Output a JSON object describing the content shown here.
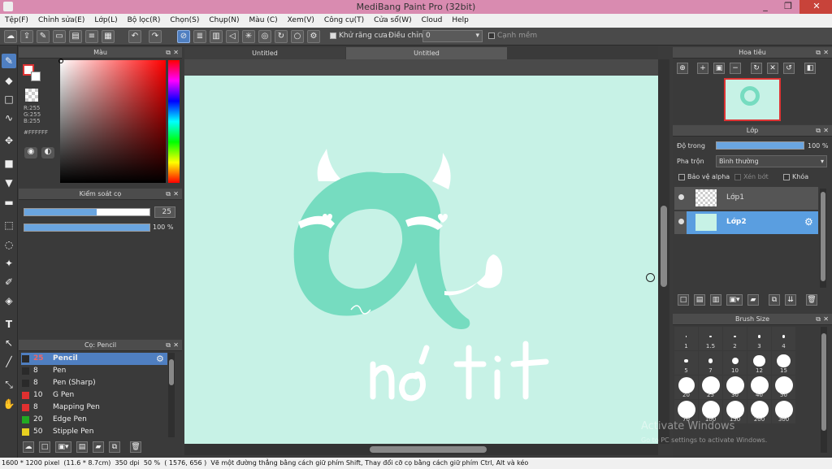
{
  "window": {
    "title": "MediBang Paint Pro (32bit)",
    "minimize": "_",
    "restore": "❐",
    "close": "✕"
  },
  "menu": [
    "Tệp(F)",
    "Chỉnh sửa(E)",
    "Lớp(L)",
    "Bộ lọc(R)",
    "Chọn(S)",
    "Chụp(N)",
    "Màu (C)",
    "Xem(V)",
    "Công cụ(T)",
    "Cửa sổ(W)",
    "Cloud",
    "Help"
  ],
  "toolbar": {
    "antialias_label": "Khử răng cưa",
    "adjust_label": "Điều chỉnh",
    "adjust_value": "0",
    "snap_label": "Cạnh mềm"
  },
  "color_panel": {
    "title": "Màu",
    "r": "R:255",
    "g": "G:255",
    "b": "B:255",
    "hex": "#FFFFFF"
  },
  "brush_control": {
    "title": "Kiểm soát cọ",
    "size": "25",
    "opacity": "100 %",
    "size_fill": 0.58,
    "opacity_fill": 1.0
  },
  "brush_panel": {
    "title": "Cọ: Pencil",
    "items": [
      {
        "size": "25",
        "name": "Pencil",
        "color": "#2a2a2a"
      },
      {
        "size": "8",
        "name": "Pen",
        "color": "#2a2a2a"
      },
      {
        "size": "8",
        "name": "Pen (Sharp)",
        "color": "#2a2a2a"
      },
      {
        "size": "10",
        "name": "G Pen",
        "color": "#e03030"
      },
      {
        "size": "8",
        "name": "Mapping Pen",
        "color": "#e03030"
      },
      {
        "size": "20",
        "name": "Edge Pen",
        "color": "#22aa22"
      },
      {
        "size": "50",
        "name": "Stipple Pen",
        "color": "#e8d020"
      }
    ]
  },
  "tabs": [
    "Untitled",
    "Untitled"
  ],
  "navigator": {
    "title": "Hoa tiêu"
  },
  "layers": {
    "title": "Lớp",
    "opacity_label": "Độ trong",
    "opacity_value": "100 %",
    "opacity_fill": 1.0,
    "blend_label": "Pha trộn",
    "blend_value": "Bình thường",
    "protect_alpha": "Bảo vệ alpha",
    "clipping": "Xén bớt",
    "lock": "Khóa",
    "items": [
      "Lớp1",
      "Lớp2"
    ]
  },
  "brush_size": {
    "title": "Brush Size",
    "sizes": [
      "1",
      "1.5",
      "2",
      "3",
      "4",
      "5",
      "7",
      "10",
      "12",
      "15",
      "20",
      "25",
      "30",
      "40",
      "50",
      "70",
      "100",
      "150",
      "200",
      "300"
    ]
  },
  "watermark": {
    "line1": "Activate Windows",
    "line2": "Go to PC settings to activate Windows."
  },
  "status": {
    "dims": "1600 * 1200 pixel",
    "cm": "(11.6 * 8.7cm)",
    "dpi": "350 dpi",
    "zoom": "50 %",
    "coords": "( 1576, 656 )",
    "hint": "Vẽ một đường thẳng bằng cách giữ phím Shift, Thay đổi cỡ cọ bằng cách giữ phím Ctrl, Alt và kéo"
  },
  "colors": {
    "canvas_bg": "#c7f2e6",
    "drawing": "#76dcc0",
    "accent": "#4f7fc1"
  }
}
